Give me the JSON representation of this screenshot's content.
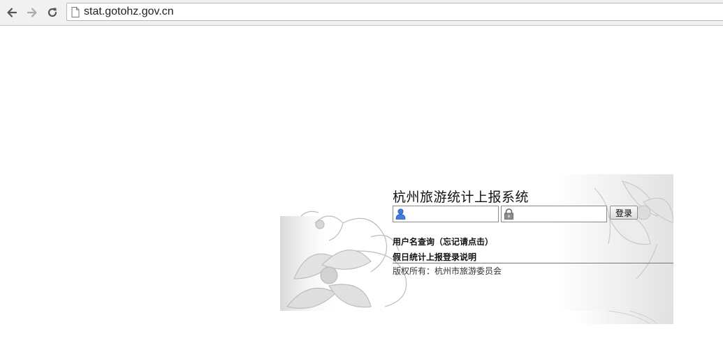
{
  "browser": {
    "url": "stat.gotohz.gov.cn",
    "icons": [
      "back-icon",
      "forward-icon",
      "reload-icon",
      "page-icon"
    ]
  },
  "login": {
    "title": "杭州旅游统计上报系统",
    "username_placeholder": "",
    "password_placeholder": "",
    "login_button": "登录",
    "username_lookup_link": "用户名查询（忘记请点击）",
    "holiday_login_link": "假日统计上报登录说明",
    "copyright": "版权所有：杭州市旅游委员会",
    "icons": [
      "user-icon",
      "lock-icon"
    ],
    "colors": {
      "user_icon": "#2a6fd6",
      "accent": "#6b6b6b"
    }
  }
}
